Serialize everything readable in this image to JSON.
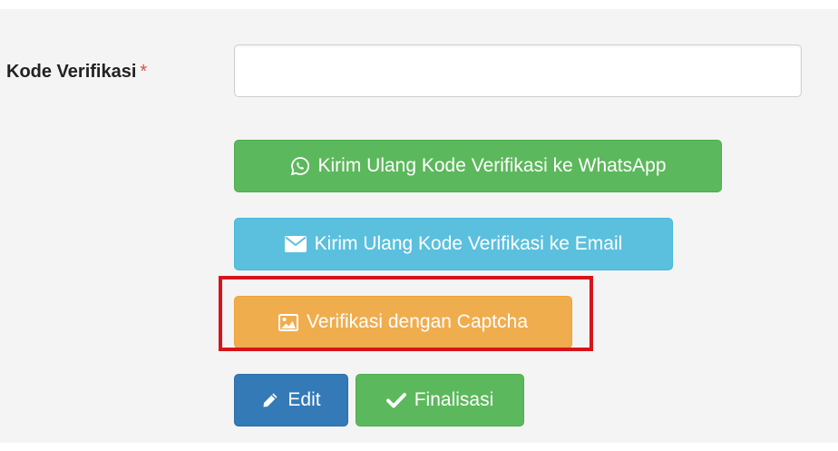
{
  "form": {
    "verification_label": "Kode Verifikasi",
    "required_marker": "*",
    "verification_input_value": "",
    "verification_input_placeholder": ""
  },
  "buttons": {
    "resend_whatsapp": {
      "label": "Kirim Ulang Kode Verifikasi ke WhatsApp",
      "icon": "whatsapp-icon",
      "color": "#5cb85c"
    },
    "resend_email": {
      "label": "Kirim Ulang Kode Verifikasi ke Email",
      "icon": "envelope-icon",
      "color": "#5bc0de"
    },
    "captcha": {
      "label": "Verifikasi dengan Captcha",
      "icon": "image-icon",
      "color": "#f0ad4e",
      "highlighted": true
    },
    "edit": {
      "label": "Edit",
      "icon": "pencil-icon",
      "color": "#337ab7"
    },
    "finalize": {
      "label": "Finalisasi",
      "icon": "check-icon",
      "color": "#5cb85c"
    }
  },
  "highlight_color": "#d6141b"
}
